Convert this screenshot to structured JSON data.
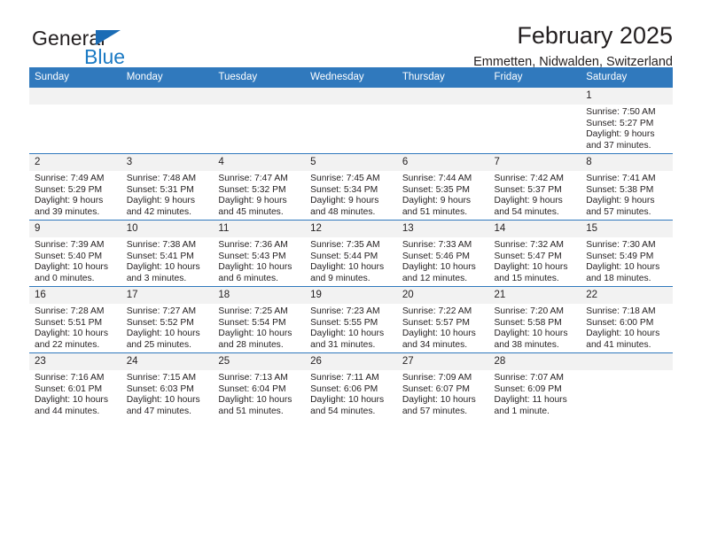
{
  "brand": {
    "name_part1": "General",
    "name_part2": "Blue",
    "triangle_color": "#1b6cb5",
    "blue_color": "#1b7ac4"
  },
  "header": {
    "title": "February 2025",
    "subtitle": "Emmetten, Nidwalden, Switzerland",
    "header_bg": "#3079bd",
    "header_text": "#ffffff",
    "daynum_bg": "#f2f2f2"
  },
  "columns": [
    "Sunday",
    "Monday",
    "Tuesday",
    "Wednesday",
    "Thursday",
    "Friday",
    "Saturday"
  ],
  "weeks": [
    [
      {
        "day": "",
        "lines": []
      },
      {
        "day": "",
        "lines": []
      },
      {
        "day": "",
        "lines": []
      },
      {
        "day": "",
        "lines": []
      },
      {
        "day": "",
        "lines": []
      },
      {
        "day": "",
        "lines": []
      },
      {
        "day": "1",
        "lines": [
          "Sunrise: 7:50 AM",
          "Sunset: 5:27 PM",
          "Daylight: 9 hours",
          "and 37 minutes."
        ]
      }
    ],
    [
      {
        "day": "2",
        "lines": [
          "Sunrise: 7:49 AM",
          "Sunset: 5:29 PM",
          "Daylight: 9 hours",
          "and 39 minutes."
        ]
      },
      {
        "day": "3",
        "lines": [
          "Sunrise: 7:48 AM",
          "Sunset: 5:31 PM",
          "Daylight: 9 hours",
          "and 42 minutes."
        ]
      },
      {
        "day": "4",
        "lines": [
          "Sunrise: 7:47 AM",
          "Sunset: 5:32 PM",
          "Daylight: 9 hours",
          "and 45 minutes."
        ]
      },
      {
        "day": "5",
        "lines": [
          "Sunrise: 7:45 AM",
          "Sunset: 5:34 PM",
          "Daylight: 9 hours",
          "and 48 minutes."
        ]
      },
      {
        "day": "6",
        "lines": [
          "Sunrise: 7:44 AM",
          "Sunset: 5:35 PM",
          "Daylight: 9 hours",
          "and 51 minutes."
        ]
      },
      {
        "day": "7",
        "lines": [
          "Sunrise: 7:42 AM",
          "Sunset: 5:37 PM",
          "Daylight: 9 hours",
          "and 54 minutes."
        ]
      },
      {
        "day": "8",
        "lines": [
          "Sunrise: 7:41 AM",
          "Sunset: 5:38 PM",
          "Daylight: 9 hours",
          "and 57 minutes."
        ]
      }
    ],
    [
      {
        "day": "9",
        "lines": [
          "Sunrise: 7:39 AM",
          "Sunset: 5:40 PM",
          "Daylight: 10 hours",
          "and 0 minutes."
        ]
      },
      {
        "day": "10",
        "lines": [
          "Sunrise: 7:38 AM",
          "Sunset: 5:41 PM",
          "Daylight: 10 hours",
          "and 3 minutes."
        ]
      },
      {
        "day": "11",
        "lines": [
          "Sunrise: 7:36 AM",
          "Sunset: 5:43 PM",
          "Daylight: 10 hours",
          "and 6 minutes."
        ]
      },
      {
        "day": "12",
        "lines": [
          "Sunrise: 7:35 AM",
          "Sunset: 5:44 PM",
          "Daylight: 10 hours",
          "and 9 minutes."
        ]
      },
      {
        "day": "13",
        "lines": [
          "Sunrise: 7:33 AM",
          "Sunset: 5:46 PM",
          "Daylight: 10 hours",
          "and 12 minutes."
        ]
      },
      {
        "day": "14",
        "lines": [
          "Sunrise: 7:32 AM",
          "Sunset: 5:47 PM",
          "Daylight: 10 hours",
          "and 15 minutes."
        ]
      },
      {
        "day": "15",
        "lines": [
          "Sunrise: 7:30 AM",
          "Sunset: 5:49 PM",
          "Daylight: 10 hours",
          "and 18 minutes."
        ]
      }
    ],
    [
      {
        "day": "16",
        "lines": [
          "Sunrise: 7:28 AM",
          "Sunset: 5:51 PM",
          "Daylight: 10 hours",
          "and 22 minutes."
        ]
      },
      {
        "day": "17",
        "lines": [
          "Sunrise: 7:27 AM",
          "Sunset: 5:52 PM",
          "Daylight: 10 hours",
          "and 25 minutes."
        ]
      },
      {
        "day": "18",
        "lines": [
          "Sunrise: 7:25 AM",
          "Sunset: 5:54 PM",
          "Daylight: 10 hours",
          "and 28 minutes."
        ]
      },
      {
        "day": "19",
        "lines": [
          "Sunrise: 7:23 AM",
          "Sunset: 5:55 PM",
          "Daylight: 10 hours",
          "and 31 minutes."
        ]
      },
      {
        "day": "20",
        "lines": [
          "Sunrise: 7:22 AM",
          "Sunset: 5:57 PM",
          "Daylight: 10 hours",
          "and 34 minutes."
        ]
      },
      {
        "day": "21",
        "lines": [
          "Sunrise: 7:20 AM",
          "Sunset: 5:58 PM",
          "Daylight: 10 hours",
          "and 38 minutes."
        ]
      },
      {
        "day": "22",
        "lines": [
          "Sunrise: 7:18 AM",
          "Sunset: 6:00 PM",
          "Daylight: 10 hours",
          "and 41 minutes."
        ]
      }
    ],
    [
      {
        "day": "23",
        "lines": [
          "Sunrise: 7:16 AM",
          "Sunset: 6:01 PM",
          "Daylight: 10 hours",
          "and 44 minutes."
        ]
      },
      {
        "day": "24",
        "lines": [
          "Sunrise: 7:15 AM",
          "Sunset: 6:03 PM",
          "Daylight: 10 hours",
          "and 47 minutes."
        ]
      },
      {
        "day": "25",
        "lines": [
          "Sunrise: 7:13 AM",
          "Sunset: 6:04 PM",
          "Daylight: 10 hours",
          "and 51 minutes."
        ]
      },
      {
        "day": "26",
        "lines": [
          "Sunrise: 7:11 AM",
          "Sunset: 6:06 PM",
          "Daylight: 10 hours",
          "and 54 minutes."
        ]
      },
      {
        "day": "27",
        "lines": [
          "Sunrise: 7:09 AM",
          "Sunset: 6:07 PM",
          "Daylight: 10 hours",
          "and 57 minutes."
        ]
      },
      {
        "day": "28",
        "lines": [
          "Sunrise: 7:07 AM",
          "Sunset: 6:09 PM",
          "Daylight: 11 hours",
          "and 1 minute."
        ]
      },
      {
        "day": "",
        "lines": []
      }
    ]
  ]
}
